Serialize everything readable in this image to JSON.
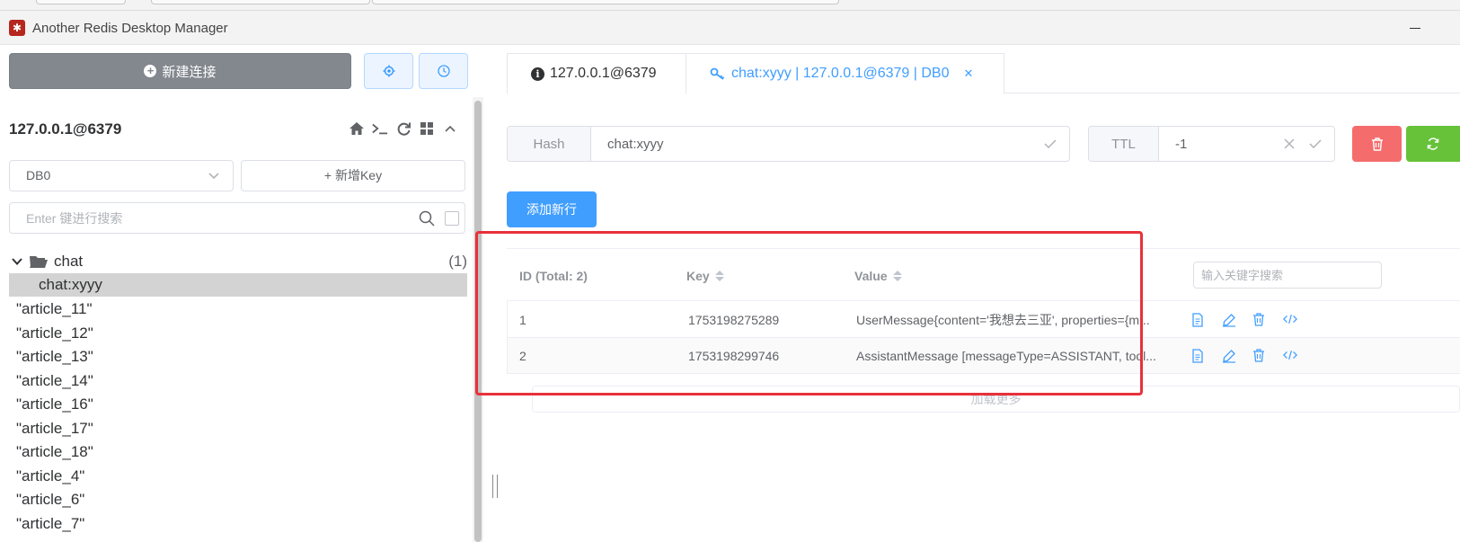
{
  "window": {
    "title": "Another Redis Desktop Manager"
  },
  "sidebar": {
    "new_connection_label": "新建连接",
    "connection_name": "127.0.0.1@6379",
    "db_select": "DB0",
    "add_key_label": "+ 新增Key",
    "search_placeholder": "Enter 键进行搜索",
    "folder": {
      "name": "chat",
      "count": "(1)"
    },
    "selected_key": "chat:xyyy",
    "keys": [
      "\"article_11\"",
      "\"article_12\"",
      "\"article_13\"",
      "\"article_14\"",
      "\"article_16\"",
      "\"article_17\"",
      "\"article_18\"",
      "\"article_4\"",
      "\"article_6\"",
      "\"article_7\""
    ]
  },
  "tabs": [
    {
      "label": "127.0.0.1@6379"
    },
    {
      "label": "chat:xyyy | 127.0.0.1@6379 | DB0"
    }
  ],
  "key_editor": {
    "type_label": "Hash",
    "key_name": "chat:xyyy",
    "ttl_label": "TTL",
    "ttl_value": "-1",
    "add_row_label": "添加新行"
  },
  "table": {
    "headers": {
      "id": "ID (Total: 2)",
      "key": "Key",
      "value": "Value"
    },
    "search_placeholder": "输入关键字搜索",
    "rows": [
      {
        "id": "1",
        "key": "1753198275289",
        "value": "UserMessage{content='我想去三亚', properties={m..."
      },
      {
        "id": "2",
        "key": "1753198299746",
        "value": "AssistantMessage [messageType=ASSISTANT, tool..."
      }
    ],
    "load_more_label": "加载更多"
  },
  "colors": {
    "primary": "#409eff",
    "danger": "#f56c6c",
    "success": "#67c23a",
    "highlight": "#e8313a"
  }
}
